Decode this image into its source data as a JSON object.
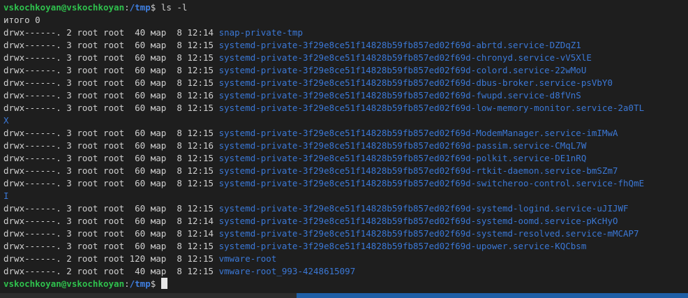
{
  "terminal": {
    "prompt_user": "vskochkoyan@vskochkoyan",
    "prompt_sep": ":",
    "prompt_path": "/tmp",
    "prompt_symbol": "$ ",
    "command": "ls -l",
    "total": "итого 0",
    "entries": [
      {
        "meta": "drwx------. 2 root root  40 мар  8 12:14 ",
        "name": "snap-private-tmp"
      },
      {
        "meta": "drwx------. 3 root root  60 мар  8 12:15 ",
        "name": "systemd-private-3f29e8ce51f14828b59fb857ed02f69d-abrtd.service-DZDqZ1"
      },
      {
        "meta": "drwx------. 3 root root  60 мар  8 12:15 ",
        "name": "systemd-private-3f29e8ce51f14828b59fb857ed02f69d-chronyd.service-vV5XlE"
      },
      {
        "meta": "drwx------. 3 root root  60 мар  8 12:15 ",
        "name": "systemd-private-3f29e8ce51f14828b59fb857ed02f69d-colord.service-22wMoU"
      },
      {
        "meta": "drwx------. 3 root root  60 мар  8 12:15 ",
        "name": "systemd-private-3f29e8ce51f14828b59fb857ed02f69d-dbus-broker.service-psVbY0"
      },
      {
        "meta": "drwx------. 3 root root  60 мар  8 12:16 ",
        "name": "systemd-private-3f29e8ce51f14828b59fb857ed02f69d-fwupd.service-d8fVnS"
      },
      {
        "meta": "drwx------. 3 root root  60 мар  8 12:15 ",
        "name": "systemd-private-3f29e8ce51f14828b59fb857ed02f69d-low-memory-monitor.service-2a0TL",
        "wrap": "X"
      },
      {
        "meta": "drwx------. 3 root root  60 мар  8 12:15 ",
        "name": "systemd-private-3f29e8ce51f14828b59fb857ed02f69d-ModemManager.service-imIMwA"
      },
      {
        "meta": "drwx------. 3 root root  60 мар  8 12:16 ",
        "name": "systemd-private-3f29e8ce51f14828b59fb857ed02f69d-passim.service-CMqL7W"
      },
      {
        "meta": "drwx------. 3 root root  60 мар  8 12:15 ",
        "name": "systemd-private-3f29e8ce51f14828b59fb857ed02f69d-polkit.service-DE1nRQ"
      },
      {
        "meta": "drwx------. 3 root root  60 мар  8 12:15 ",
        "name": "systemd-private-3f29e8ce51f14828b59fb857ed02f69d-rtkit-daemon.service-bmSZm7"
      },
      {
        "meta": "drwx------. 3 root root  60 мар  8 12:15 ",
        "name": "systemd-private-3f29e8ce51f14828b59fb857ed02f69d-switcheroo-control.service-fhQmE",
        "wrap": "I"
      },
      {
        "meta": "drwx------. 3 root root  60 мар  8 12:15 ",
        "name": "systemd-private-3f29e8ce51f14828b59fb857ed02f69d-systemd-logind.service-uJIJWF"
      },
      {
        "meta": "drwx------. 3 root root  60 мар  8 12:14 ",
        "name": "systemd-private-3f29e8ce51f14828b59fb857ed02f69d-systemd-oomd.service-pKcHyO"
      },
      {
        "meta": "drwx------. 3 root root  60 мар  8 12:14 ",
        "name": "systemd-private-3f29e8ce51f14828b59fb857ed02f69d-systemd-resolved.service-mMCAP7"
      },
      {
        "meta": "drwx------. 3 root root  60 мар  8 12:15 ",
        "name": "systemd-private-3f29e8ce51f14828b59fb857ed02f69d-upower.service-KQCbsm"
      },
      {
        "meta": "drwx------. 2 root root 120 мар  8 12:15 ",
        "name": "vmware-root"
      },
      {
        "meta": "drwx------. 2 root root  40 мар  8 12:15 ",
        "name": "vmware-root_993-4248615097"
      }
    ]
  },
  "colors": {
    "background": "#1e1e1e",
    "text": "#d0d0d0",
    "prompt_user": "#2fc14d",
    "prompt_path": "#3f7fe0",
    "directory_name": "#3b78d6"
  }
}
